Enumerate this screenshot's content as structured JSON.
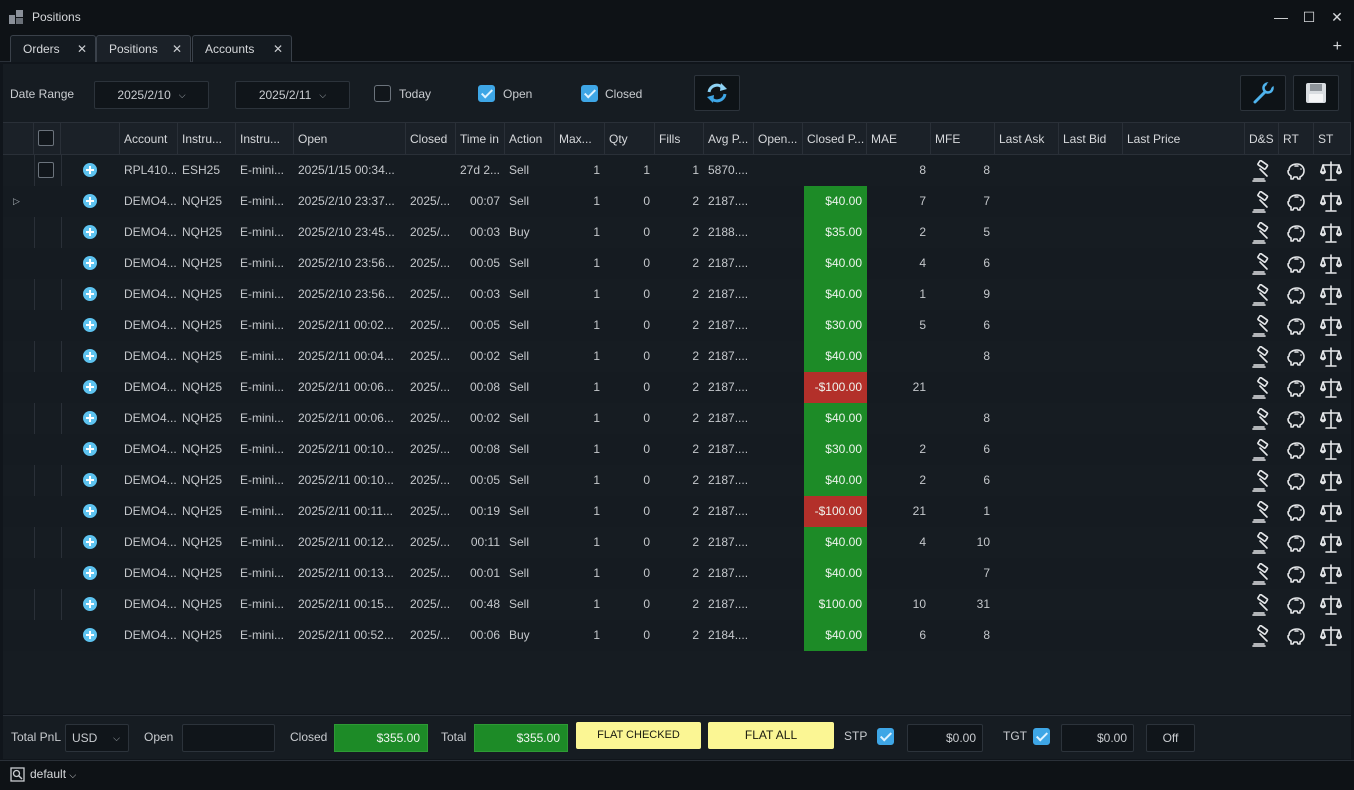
{
  "window": {
    "title": "Positions",
    "minimize_glyph": "—",
    "maximize_glyph": "☐",
    "close_glyph": "✕"
  },
  "tabs": [
    {
      "label": "Orders"
    },
    {
      "label": "Positions",
      "active": true
    },
    {
      "label": "Accounts"
    }
  ],
  "tab_close_glyph": "✕",
  "tab_add_glyph": "+",
  "toolbar": {
    "date_range_label": "Date Range",
    "date_from": "2025/2/10",
    "date_to": "2025/2/11",
    "today_label": "Today",
    "today_checked": false,
    "open_label": "Open",
    "open_checked": true,
    "closed_label": "Closed",
    "closed_checked": true,
    "refresh_icon": "refresh-icon",
    "settings_icon": "wrench-icon",
    "save_icon": "save-icon"
  },
  "columns": [
    {
      "key": "select",
      "label": ""
    },
    {
      "key": "expand",
      "label": ""
    },
    {
      "key": "account",
      "label": "Account"
    },
    {
      "key": "instrument",
      "label": "Instru..."
    },
    {
      "key": "instrument_desc",
      "label": "Instru..."
    },
    {
      "key": "open",
      "label": "Open"
    },
    {
      "key": "closed",
      "label": "Closed"
    },
    {
      "key": "time_in",
      "label": "Time in"
    },
    {
      "key": "action",
      "label": "Action"
    },
    {
      "key": "max",
      "label": "Max..."
    },
    {
      "key": "qty",
      "label": "Qty"
    },
    {
      "key": "fills",
      "label": "Fills"
    },
    {
      "key": "avg_price",
      "label": "Avg P..."
    },
    {
      "key": "open_pnl",
      "label": "Open..."
    },
    {
      "key": "closed_pnl",
      "label": "Closed P..."
    },
    {
      "key": "mae",
      "label": "MAE"
    },
    {
      "key": "mfe",
      "label": "MFE"
    },
    {
      "key": "last_ask",
      "label": "Last Ask"
    },
    {
      "key": "last_bid",
      "label": "Last Bid"
    },
    {
      "key": "last_price",
      "label": "Last Price"
    },
    {
      "key": "ds",
      "label": "D&S"
    },
    {
      "key": "rt",
      "label": "RT"
    },
    {
      "key": "st",
      "label": "ST"
    }
  ],
  "rows": [
    {
      "account": "RPL410...",
      "instrument": "ESH25",
      "instrument_desc": "E-mini...",
      "open": "2025/1/15 00:34...",
      "closed": "",
      "time_in": "27d 2...",
      "action": "Sell",
      "max": "1",
      "qty": "1",
      "fills": "1",
      "avg_price": "5870....",
      "open_pnl": "",
      "closed_pnl": "",
      "pnl_sign": "",
      "mae": "8",
      "mfe": "8",
      "checkbox": true
    },
    {
      "account": "DEMO4...",
      "instrument": "NQH25",
      "instrument_desc": "E-mini...",
      "open": "2025/2/10 23:37...",
      "closed": "2025/...",
      "time_in": "00:07",
      "action": "Sell",
      "max": "1",
      "qty": "0",
      "fills": "2",
      "avg_price": "2187....",
      "open_pnl": "",
      "closed_pnl": "$40.00",
      "pnl_sign": "pos",
      "mae": "7",
      "mfe": "7",
      "selected": true
    },
    {
      "account": "DEMO4...",
      "instrument": "NQH25",
      "instrument_desc": "E-mini...",
      "open": "2025/2/10 23:45...",
      "closed": "2025/...",
      "time_in": "00:03",
      "action": "Buy",
      "max": "1",
      "qty": "0",
      "fills": "2",
      "avg_price": "2188....",
      "open_pnl": "",
      "closed_pnl": "$35.00",
      "pnl_sign": "pos",
      "mae": "2",
      "mfe": "5"
    },
    {
      "account": "DEMO4...",
      "instrument": "NQH25",
      "instrument_desc": "E-mini...",
      "open": "2025/2/10 23:56...",
      "closed": "2025/...",
      "time_in": "00:05",
      "action": "Sell",
      "max": "1",
      "qty": "0",
      "fills": "2",
      "avg_price": "2187....",
      "open_pnl": "",
      "closed_pnl": "$40.00",
      "pnl_sign": "pos",
      "mae": "4",
      "mfe": "6"
    },
    {
      "account": "DEMO4...",
      "instrument": "NQH25",
      "instrument_desc": "E-mini...",
      "open": "2025/2/10 23:56...",
      "closed": "2025/...",
      "time_in": "00:03",
      "action": "Sell",
      "max": "1",
      "qty": "0",
      "fills": "2",
      "avg_price": "2187....",
      "open_pnl": "",
      "closed_pnl": "$40.00",
      "pnl_sign": "pos",
      "mae": "1",
      "mfe": "9"
    },
    {
      "account": "DEMO4...",
      "instrument": "NQH25",
      "instrument_desc": "E-mini...",
      "open": "2025/2/11 00:02...",
      "closed": "2025/...",
      "time_in": "00:05",
      "action": "Sell",
      "max": "1",
      "qty": "0",
      "fills": "2",
      "avg_price": "2187....",
      "open_pnl": "",
      "closed_pnl": "$30.00",
      "pnl_sign": "pos",
      "mae": "5",
      "mfe": "6"
    },
    {
      "account": "DEMO4...",
      "instrument": "NQH25",
      "instrument_desc": "E-mini...",
      "open": "2025/2/11 00:04...",
      "closed": "2025/...",
      "time_in": "00:02",
      "action": "Sell",
      "max": "1",
      "qty": "0",
      "fills": "2",
      "avg_price": "2187....",
      "open_pnl": "",
      "closed_pnl": "$40.00",
      "pnl_sign": "pos",
      "mae": "",
      "mfe": "8"
    },
    {
      "account": "DEMO4...",
      "instrument": "NQH25",
      "instrument_desc": "E-mini...",
      "open": "2025/2/11 00:06...",
      "closed": "2025/...",
      "time_in": "00:08",
      "action": "Sell",
      "max": "1",
      "qty": "0",
      "fills": "2",
      "avg_price": "2187....",
      "open_pnl": "",
      "closed_pnl": "-$100.00",
      "pnl_sign": "neg",
      "mae": "21",
      "mfe": ""
    },
    {
      "account": "DEMO4...",
      "instrument": "NQH25",
      "instrument_desc": "E-mini...",
      "open": "2025/2/11 00:06...",
      "closed": "2025/...",
      "time_in": "00:02",
      "action": "Sell",
      "max": "1",
      "qty": "0",
      "fills": "2",
      "avg_price": "2187....",
      "open_pnl": "",
      "closed_pnl": "$40.00",
      "pnl_sign": "pos",
      "mae": "",
      "mfe": "8"
    },
    {
      "account": "DEMO4...",
      "instrument": "NQH25",
      "instrument_desc": "E-mini...",
      "open": "2025/2/11 00:10...",
      "closed": "2025/...",
      "time_in": "00:08",
      "action": "Sell",
      "max": "1",
      "qty": "0",
      "fills": "2",
      "avg_price": "2187....",
      "open_pnl": "",
      "closed_pnl": "$30.00",
      "pnl_sign": "pos",
      "mae": "2",
      "mfe": "6"
    },
    {
      "account": "DEMO4...",
      "instrument": "NQH25",
      "instrument_desc": "E-mini...",
      "open": "2025/2/11 00:10...",
      "closed": "2025/...",
      "time_in": "00:05",
      "action": "Sell",
      "max": "1",
      "qty": "0",
      "fills": "2",
      "avg_price": "2187....",
      "open_pnl": "",
      "closed_pnl": "$40.00",
      "pnl_sign": "pos",
      "mae": "2",
      "mfe": "6"
    },
    {
      "account": "DEMO4...",
      "instrument": "NQH25",
      "instrument_desc": "E-mini...",
      "open": "2025/2/11 00:11...",
      "closed": "2025/...",
      "time_in": "00:19",
      "action": "Sell",
      "max": "1",
      "qty": "0",
      "fills": "2",
      "avg_price": "2187....",
      "open_pnl": "",
      "closed_pnl": "-$100.00",
      "pnl_sign": "neg",
      "mae": "21",
      "mfe": "1"
    },
    {
      "account": "DEMO4...",
      "instrument": "NQH25",
      "instrument_desc": "E-mini...",
      "open": "2025/2/11 00:12...",
      "closed": "2025/...",
      "time_in": "00:11",
      "action": "Sell",
      "max": "1",
      "qty": "0",
      "fills": "2",
      "avg_price": "2187....",
      "open_pnl": "",
      "closed_pnl": "$40.00",
      "pnl_sign": "pos",
      "mae": "4",
      "mfe": "10"
    },
    {
      "account": "DEMO4...",
      "instrument": "NQH25",
      "instrument_desc": "E-mini...",
      "open": "2025/2/11 00:13...",
      "closed": "2025/...",
      "time_in": "00:01",
      "action": "Sell",
      "max": "1",
      "qty": "0",
      "fills": "2",
      "avg_price": "2187....",
      "open_pnl": "",
      "closed_pnl": "$40.00",
      "pnl_sign": "pos",
      "mae": "",
      "mfe": "7"
    },
    {
      "account": "DEMO4...",
      "instrument": "NQH25",
      "instrument_desc": "E-mini...",
      "open": "2025/2/11 00:15...",
      "closed": "2025/...",
      "time_in": "00:48",
      "action": "Sell",
      "max": "1",
      "qty": "0",
      "fills": "2",
      "avg_price": "2187....",
      "open_pnl": "",
      "closed_pnl": "$100.00",
      "pnl_sign": "pos",
      "mae": "10",
      "mfe": "31"
    },
    {
      "account": "DEMO4...",
      "instrument": "NQH25",
      "instrument_desc": "E-mini...",
      "open": "2025/2/11 00:52...",
      "closed": "2025/...",
      "time_in": "00:06",
      "action": "Buy",
      "max": "1",
      "qty": "0",
      "fills": "2",
      "avg_price": "2184....",
      "open_pnl": "",
      "closed_pnl": "$40.00",
      "pnl_sign": "pos",
      "mae": "6",
      "mfe": "8"
    }
  ],
  "row_icons": {
    "ds": "gavel-icon",
    "rt": "piggy-bank-icon",
    "st": "scales-icon"
  },
  "footer": {
    "total_pnl_label": "Total PnL",
    "currency": "USD",
    "open_label": "Open",
    "open_value": "",
    "closed_label": "Closed",
    "closed_value": "$355.00",
    "total_label": "Total",
    "total_value": "$355.00",
    "flat_checked_label": "FLAT CHECKED",
    "flat_all_label": "FLAT ALL",
    "stp_label": "STP",
    "stp_checked": true,
    "stp_value": "$0.00",
    "tgt_label": "TGT",
    "tgt_checked": true,
    "tgt_value": "$0.00",
    "off_label": "Off"
  },
  "statusbar": {
    "profile": "default",
    "profile_icon": "search-doc-icon"
  },
  "colors": {
    "profit": "#1d8b27",
    "loss": "#b3302a",
    "accent": "#3ea6e6",
    "flat_button": "#fbf694"
  }
}
